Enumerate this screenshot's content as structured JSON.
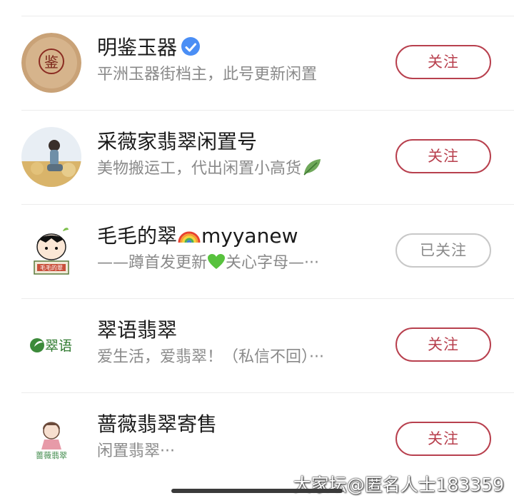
{
  "accounts": [
    {
      "name": "明鉴玉器",
      "verified": true,
      "description": "平洲玉器街档主，此号更新闲置",
      "button": "关注",
      "avatar_text": "鉴"
    },
    {
      "name": "采薇家翡翠闲置号",
      "description": "美物搬运工，代出闲置小高货",
      "description_icon": "leaf-icon",
      "button": "关注"
    },
    {
      "name_prefix": "毛毛的翠",
      "name_icon": "rainbow-icon",
      "name_suffix": "myyanew",
      "description_prefix": "——蹲首发更新",
      "description_icon": "green-heart-icon",
      "description_suffix": "关心字母—···",
      "button": "已关注",
      "avatar_text": "毛毛的翠"
    },
    {
      "name": "翠语翡翠",
      "description": "爱生活，爱翡翠！（私信不回）···",
      "button": "关注",
      "avatar_text": "翠语"
    },
    {
      "name": "蔷薇翡翠寄售",
      "description": "闲置翡翠···",
      "button": "关注",
      "avatar_text": "蔷薇翡翠"
    }
  ],
  "watermark": "大家坛@匿名人士183359",
  "colors": {
    "accent": "#b8404e",
    "followed_border": "#c8c8c8",
    "verify_blue": "#4a8ef5"
  }
}
